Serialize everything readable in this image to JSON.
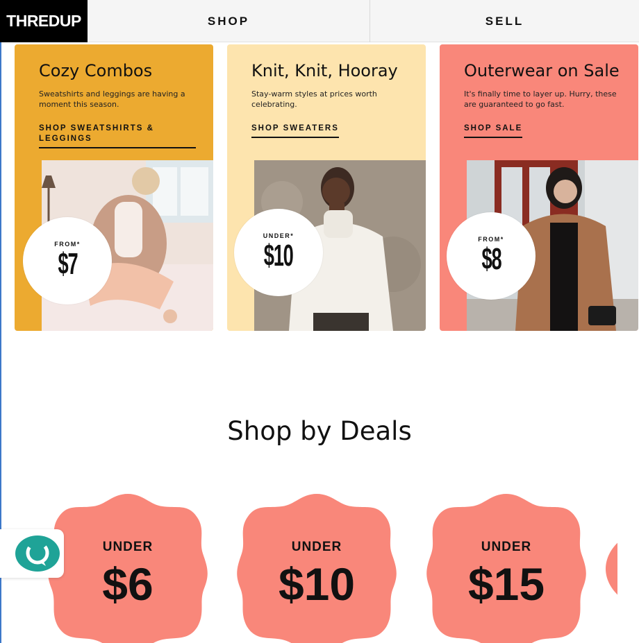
{
  "header": {
    "logo_text": "THREDUP",
    "nav": {
      "shop": "SHOP",
      "sell": "SELL"
    }
  },
  "promo_cards": [
    {
      "title": "Cozy Combos",
      "description": "Sweatshirts and leggings are having a moment this season.",
      "link": "SHOP SWEATSHIRTS & LEGGINGS",
      "badge_label": "FROM*",
      "badge_price": "$7",
      "bg_color": "#ecaa30"
    },
    {
      "title": "Knit, Knit, Hooray",
      "description": "Stay-warm styles at prices worth celebrating.",
      "link": "SHOP SWEATERS",
      "badge_label": "UNDER*",
      "badge_price": "$10",
      "bg_color": "#fde4ae"
    },
    {
      "title": "Outerwear on Sale",
      "description": "It's finally time to layer up. Hurry, these are guaranteed to go fast.",
      "link": "SHOP SALE",
      "badge_label": "FROM*",
      "badge_price": "$8",
      "bg_color": "#f9877a"
    }
  ],
  "deals_section": {
    "title": "Shop by Deals",
    "deals": [
      {
        "label": "UNDER",
        "amount": "$6"
      },
      {
        "label": "UNDER",
        "amount": "$10"
      },
      {
        "label": "UNDER",
        "amount": "$15"
      }
    ],
    "badge_color": "#f9877a"
  },
  "chat": {
    "icon": "chat-support-icon",
    "color": "#1fa397"
  }
}
